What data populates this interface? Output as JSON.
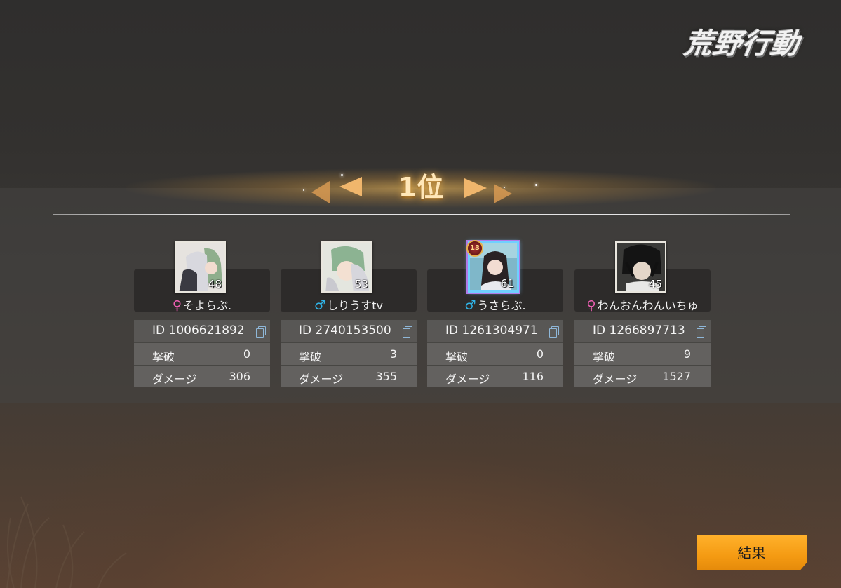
{
  "game": {
    "logo_text": "荒野行動"
  },
  "rank": {
    "label": "1位"
  },
  "players": [
    {
      "name": "そよらぶ.",
      "gender": "female",
      "gender_symbol": "♀",
      "level": "48",
      "id_text": "ID 1006621892",
      "kills_label": "撃破",
      "kills": "0",
      "damage_label": "ダメージ",
      "damage": "306"
    },
    {
      "name": "しりうすtv",
      "gender": "male",
      "gender_symbol": "♂",
      "level": "53",
      "id_text": "ID 2740153500",
      "kills_label": "撃破",
      "kills": "3",
      "damage_label": "ダメージ",
      "damage": "355"
    },
    {
      "name": "うさらぶ.",
      "gender": "male",
      "gender_symbol": "♂",
      "level": "61",
      "id_text": "ID 1261304971",
      "kills_label": "撃破",
      "kills": "0",
      "damage_label": "ダメージ",
      "damage": "116"
    },
    {
      "name": "わんおんわんいちゅ",
      "gender": "female",
      "gender_symbol": "♀",
      "level": "45",
      "id_text": "ID 1266897713",
      "kills_label": "撃破",
      "kills": "9",
      "damage_label": "ダメージ",
      "damage": "1527"
    }
  ],
  "buttons": {
    "result_label": "結果"
  },
  "colors": {
    "accent": "#f49a12",
    "female": "#ef5fb4",
    "male": "#2fb4e8",
    "rank_gold": "#ffe7b8"
  }
}
